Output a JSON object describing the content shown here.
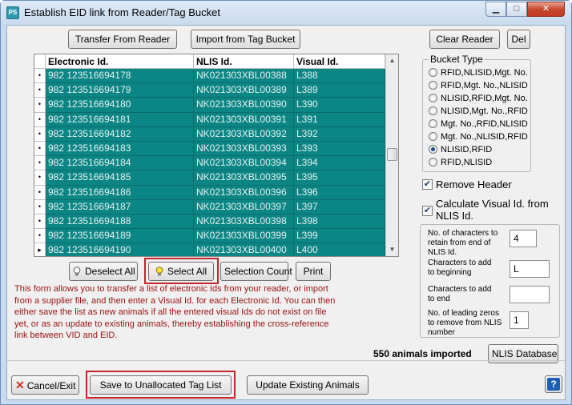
{
  "window": {
    "title": "Establish EID link from Reader/Tag Bucket",
    "icon_text": "PS"
  },
  "toolbar": {
    "transfer_from_reader": "Transfer From Reader",
    "import_from_tag_bucket": "Import from Tag Bucket",
    "clear_reader": "Clear Reader",
    "del": "Del"
  },
  "grid": {
    "columns": [
      "Electronic Id.",
      "NLIS Id.",
      "Visual Id."
    ],
    "rows": [
      {
        "marker": "•",
        "eid": "982 123516694178",
        "nlis": "NK021303XBL00388",
        "visual": "L388"
      },
      {
        "marker": "•",
        "eid": "982 123516694179",
        "nlis": "NK021303XBL00389",
        "visual": "L389"
      },
      {
        "marker": "•",
        "eid": "982 123516694180",
        "nlis": "NK021303XBL00390",
        "visual": "L390"
      },
      {
        "marker": "•",
        "eid": "982 123516694181",
        "nlis": "NK021303XBL00391",
        "visual": "L391"
      },
      {
        "marker": "•",
        "eid": "982 123516694182",
        "nlis": "NK021303XBL00392",
        "visual": "L392"
      },
      {
        "marker": "•",
        "eid": "982 123516694183",
        "nlis": "NK021303XBL00393",
        "visual": "L393"
      },
      {
        "marker": "•",
        "eid": "982 123516694184",
        "nlis": "NK021303XBL00394",
        "visual": "L394"
      },
      {
        "marker": "•",
        "eid": "982 123516694185",
        "nlis": "NK021303XBL00395",
        "visual": "L395"
      },
      {
        "marker": "•",
        "eid": "982 123516694186",
        "nlis": "NK021303XBL00396",
        "visual": "L396"
      },
      {
        "marker": "•",
        "eid": "982 123516694187",
        "nlis": "NK021303XBL00397",
        "visual": "L397"
      },
      {
        "marker": "•",
        "eid": "982 123516694188",
        "nlis": "NK021303XBL00398",
        "visual": "L398"
      },
      {
        "marker": "•",
        "eid": "982 123516694189",
        "nlis": "NK021303XBL00399",
        "visual": "L399"
      },
      {
        "marker": "▸",
        "eid": "982 123516694190",
        "nlis": "NK021303XBL00400",
        "visual": "L400"
      }
    ]
  },
  "grid_buttons": {
    "deselect_all": "Deselect All",
    "select_all": "Select All",
    "selection_count": "Selection Count",
    "print": "Print"
  },
  "info_text": "This form allows you to transfer a list of electronic Ids from your reader, or import from a supplier file, and then enter a Visual Id. for each Electronic Id. You can then either save the list as new animals if all the entered visual Ids do not exist on file yet, or as an update to existing animals, thereby establishing the cross-reference link between VID and EID.",
  "bucket_type": {
    "title": "Bucket Type",
    "options": [
      {
        "label": "RFID,NLISID,Mgt. No.",
        "selected": false
      },
      {
        "label": "RFID,Mgt. No.,NLISID",
        "selected": false
      },
      {
        "label": "NLISID,RFID,Mgt. No.",
        "selected": false
      },
      {
        "label": "NLISID,Mgt. No.,RFID",
        "selected": false
      },
      {
        "label": "Mgt. No.,RFID,NLISID",
        "selected": false
      },
      {
        "label": "Mgt. No.,NLISID,RFID",
        "selected": false
      },
      {
        "label": "NLISID,RFID",
        "selected": true
      },
      {
        "label": "RFID,NLISID",
        "selected": false
      }
    ]
  },
  "options": {
    "remove_header": "Remove Header",
    "remove_header_checked": true,
    "calc_visual": "Calculate Visual Id. from NLIS Id.",
    "calc_visual_checked": true
  },
  "nlis_fields": {
    "chars_retain_label": "No. of characters to retain from end of NLIS Id.",
    "chars_retain_value": "4",
    "chars_add_begin_label": "Characters to add to beginning",
    "chars_add_begin_value": "L",
    "chars_add_end_label": "Characters to add to end",
    "chars_add_end_value": "",
    "leading_zeros_label": "No. of leading zeros to remove from NLIS number",
    "leading_zeros_value": "1"
  },
  "status": {
    "imported": "550 animals imported"
  },
  "nlis_database": "NLIS Database",
  "bottom": {
    "cancel_exit": "Cancel/Exit",
    "save_unallocated": "Save to Unallocated Tag List",
    "update_existing": "Update Existing Animals",
    "help": "?"
  }
}
